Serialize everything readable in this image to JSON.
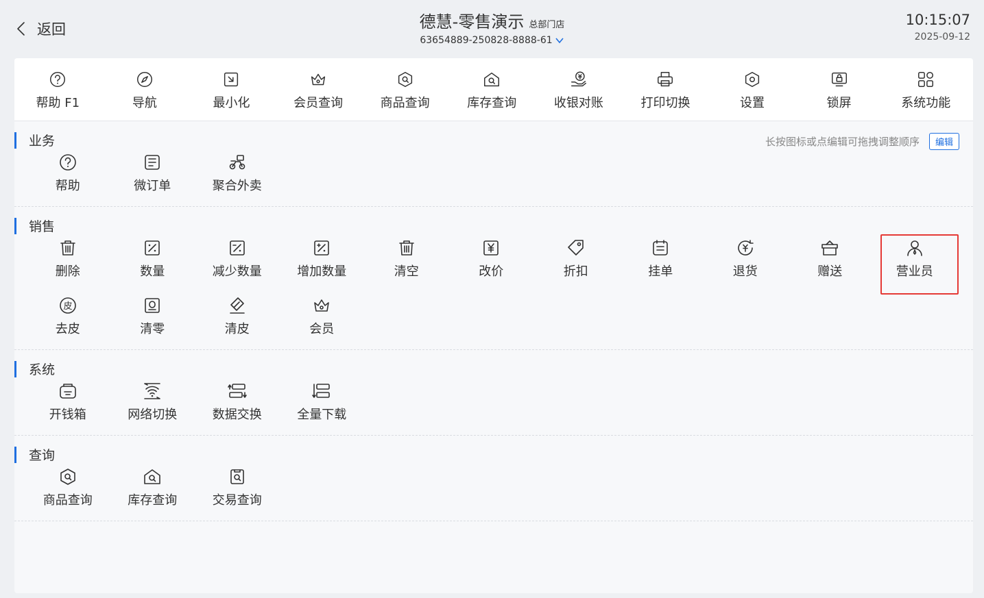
{
  "header": {
    "back_label": "返回",
    "title": "德慧-零售演示",
    "store": "总部门店",
    "device_id": "63654889-250828-8888-61",
    "time": "10:15:07",
    "date": "2025-09-12"
  },
  "toolbar": [
    {
      "label": "帮助 F1",
      "icon": "help-icon"
    },
    {
      "label": "导航",
      "icon": "compass-icon"
    },
    {
      "label": "最小化",
      "icon": "minimize-icon"
    },
    {
      "label": "会员查询",
      "icon": "crown-icon"
    },
    {
      "label": "商品查询",
      "icon": "product-search-icon"
    },
    {
      "label": "库存查询",
      "icon": "warehouse-search-icon"
    },
    {
      "label": "收银对账",
      "icon": "cash-reconcile-icon"
    },
    {
      "label": "打印切换",
      "icon": "printer-icon"
    },
    {
      "label": "设置",
      "icon": "settings-icon"
    },
    {
      "label": "锁屏",
      "icon": "lock-screen-icon"
    },
    {
      "label": "系统功能",
      "icon": "apps-icon"
    }
  ],
  "hint": {
    "text": "长按图标或点编辑可拖拽调整顺序",
    "edit_label": "编辑"
  },
  "sections": [
    {
      "name": "业务",
      "items": [
        {
          "label": "帮助",
          "icon": "help-icon"
        },
        {
          "label": "微订单",
          "icon": "micro-order-icon"
        },
        {
          "label": "聚合外卖",
          "icon": "delivery-scooter-icon"
        }
      ]
    },
    {
      "name": "销售",
      "items": [
        {
          "label": "删除",
          "icon": "trash-icon"
        },
        {
          "label": "数量",
          "icon": "quantity-icon"
        },
        {
          "label": "减少数量",
          "icon": "quantity-minus-icon"
        },
        {
          "label": "增加数量",
          "icon": "quantity-plus-icon"
        },
        {
          "label": "清空",
          "icon": "trash-icon"
        },
        {
          "label": "改价",
          "icon": "price-change-icon"
        },
        {
          "label": "折扣",
          "icon": "tag-icon"
        },
        {
          "label": "挂单",
          "icon": "hold-order-icon"
        },
        {
          "label": "退货",
          "icon": "refund-icon"
        },
        {
          "label": "赠送",
          "icon": "gift-icon"
        },
        {
          "label": "营业员",
          "icon": "salesperson-icon",
          "highlighted": true
        },
        {
          "label": "去皮",
          "icon": "tare-icon"
        },
        {
          "label": "清零",
          "icon": "zero-scale-icon"
        },
        {
          "label": "清皮",
          "icon": "eraser-icon"
        },
        {
          "label": "会员",
          "icon": "crown-icon"
        }
      ]
    },
    {
      "name": "系统",
      "items": [
        {
          "label": "开钱箱",
          "icon": "cash-drawer-icon"
        },
        {
          "label": "网络切换",
          "icon": "wifi-switch-icon"
        },
        {
          "label": "数据交换",
          "icon": "data-exchange-icon"
        },
        {
          "label": "全量下载",
          "icon": "full-download-icon"
        }
      ]
    },
    {
      "name": "查询",
      "items": [
        {
          "label": "商品查询",
          "icon": "product-search-icon"
        },
        {
          "label": "库存查询",
          "icon": "warehouse-search-icon"
        },
        {
          "label": "交易查询",
          "icon": "transaction-search-icon"
        }
      ]
    }
  ],
  "colors": {
    "accent": "#1f6fe0",
    "highlight_border": "#e53935",
    "background": "#eef0f3",
    "panel": "#f7f8fa"
  }
}
